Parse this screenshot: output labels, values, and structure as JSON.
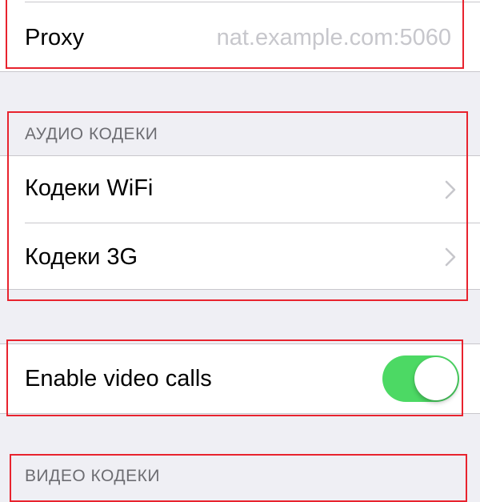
{
  "proxy": {
    "label": "Proxy",
    "value": "nat.example.com:5060"
  },
  "audio_codecs": {
    "header": "АУДИО КОДЕКИ",
    "items": [
      {
        "label": "Кодеки WiFi",
        "icon": "chevron-right-icon"
      },
      {
        "label": "Кодеки 3G",
        "icon": "chevron-right-icon"
      }
    ]
  },
  "video_calls": {
    "label": "Enable video calls",
    "enabled": true
  },
  "video_codecs": {
    "header": "ВИДЕО КОДЕКИ"
  },
  "colors": {
    "background": "#efeff4",
    "cell": "#ffffff",
    "separator": "#c8c7cc",
    "toggle_on": "#4cd964",
    "chevron": "#c7c7cc",
    "highlight_box": "#e8232e",
    "section_header_text": "#6d6d72"
  }
}
